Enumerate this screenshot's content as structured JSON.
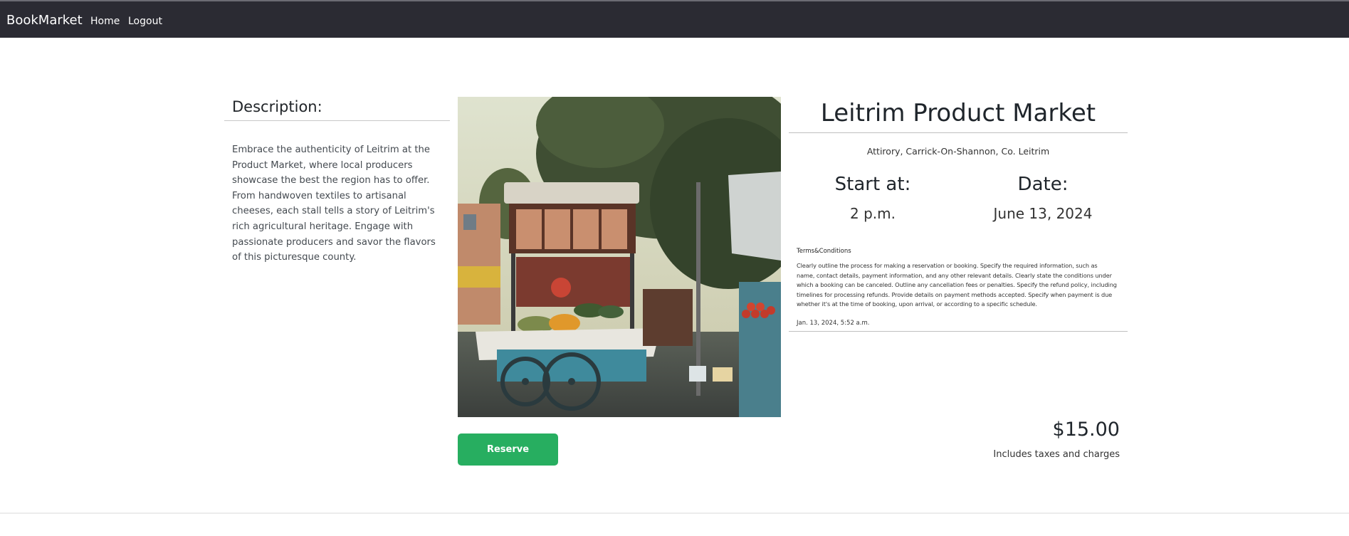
{
  "navbar": {
    "brand": "BookMarket",
    "links": [
      "Home",
      "Logout"
    ]
  },
  "description": {
    "heading": "Description:",
    "text": "Embrace the authenticity of Leitrim at the Product Market, where local producers showcase the best the region has to offer. From handwoven textiles to artisanal cheeses, each stall tells a story of Leitrim's rich agricultural heritage. Engage with passionate producers and savor the flavors of this picturesque county."
  },
  "event": {
    "title": "Leitrim Product Market",
    "address": "Attirory, Carrick-On-Shannon, Co. Leitrim",
    "start_label": "Start at:",
    "start_value": "2 p.m.",
    "date_label": "Date:",
    "date_value": "June 13, 2024"
  },
  "terms": {
    "heading": "Terms&Conditions",
    "text": "Clearly outline the process for making a reservation or booking. Specify the required information, such as name, contact details, payment information, and any other relevant details. Clearly state the conditions under which a booking can be canceled. Outline any cancellation fees or penalties. Specify the refund policy, including timelines for processing refunds. Provide details on payment methods accepted. Specify when payment is due whether it's at the time of booking, upon arrival, or according to a specific schedule.",
    "posted": "Jan. 13, 2024, 5:52 a.m."
  },
  "reserve_label": "Reserve",
  "price": {
    "amount": "$15.00",
    "note": "Includes taxes and charges"
  },
  "colors": {
    "navbar": "#2b2b33",
    "reserve": "#27ae60"
  }
}
